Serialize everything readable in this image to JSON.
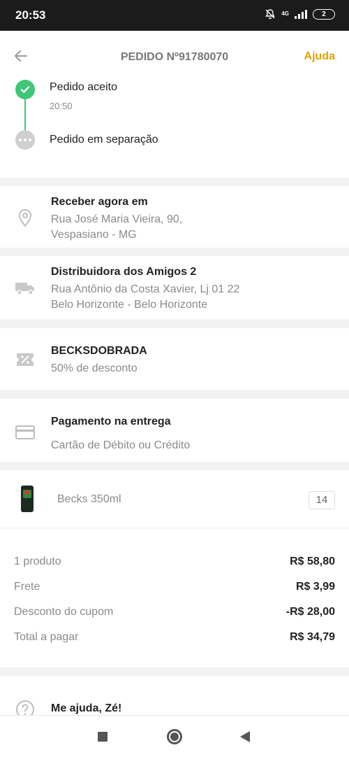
{
  "status_bar": {
    "time": "20:53",
    "network": "4G",
    "battery": "2"
  },
  "header": {
    "title": "PEDIDO Nº91780070",
    "help": "Ajuda"
  },
  "timeline": [
    {
      "label": "Pedido aceito",
      "time": "20:50",
      "state": "done"
    },
    {
      "label": "Pedido em separação",
      "state": "pending"
    }
  ],
  "delivery": {
    "title": "Receber agora em",
    "line1": "Rua José Maria Vieira, 90,",
    "line2": "Vespasiano - MG",
    "icon": "location-pin-icon"
  },
  "store": {
    "name": "Distribuidora dos Amigos 2",
    "line1": "Rua Antônio da Costa Xavier, Lj 01 22",
    "line2": "Belo Horizonte - Belo Horizonte",
    "icon": "truck-icon"
  },
  "coupon": {
    "code": "BECKSDOBRADA",
    "desc": "50% de desconto",
    "icon": "coupon-icon"
  },
  "payment": {
    "title": "Pagamento na entrega",
    "method": "Cartão de Débito ou Crédito",
    "icon": "card-icon"
  },
  "product": {
    "name": "Becks 350ml",
    "qty": "14"
  },
  "summary": [
    {
      "label": "1 produto",
      "value": "R$ 58,80"
    },
    {
      "label": "Frete",
      "value": "R$ 3,99"
    },
    {
      "label": "Desconto do cupom",
      "value": "-R$ 28,00"
    },
    {
      "label": "Total a pagar",
      "value": "R$ 34,79"
    }
  ],
  "help_section": {
    "title": "Me ajuda, Zé!",
    "icon": "question-icon"
  },
  "colors": {
    "accent": "#e5a200",
    "success": "#3ec775"
  }
}
